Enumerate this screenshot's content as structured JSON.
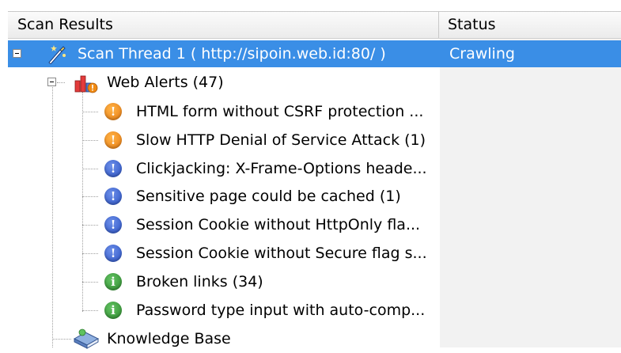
{
  "header": {
    "col1": "Scan Results",
    "col2": "Status"
  },
  "scan_thread": {
    "label": "Scan Thread 1 ( http://sipoin.web.id:80/ )",
    "status": "Crawling"
  },
  "web_alerts": {
    "label": "Web Alerts (47)"
  },
  "alerts": [
    {
      "label": "HTML form without CSRF protection ...",
      "severity": "medium"
    },
    {
      "label": "Slow HTTP Denial of Service Attack (1)",
      "severity": "medium"
    },
    {
      "label": "Clickjacking: X-Frame-Options heade...",
      "severity": "low"
    },
    {
      "label": "Sensitive page could be cached (1)",
      "severity": "low"
    },
    {
      "label": "Session Cookie without HttpOnly fla...",
      "severity": "low"
    },
    {
      "label": "Session Cookie without Secure flag s...",
      "severity": "low"
    },
    {
      "label": "Broken links (34)",
      "severity": "info"
    },
    {
      "label": "Password type input with auto-comp...",
      "severity": "info"
    }
  ],
  "knowledge_base": {
    "label": "Knowledge Base"
  },
  "colors": {
    "selection": "#3a8ee6",
    "medium": "#e87b10",
    "low": "#2a52c6",
    "info": "#2e8b2e"
  }
}
